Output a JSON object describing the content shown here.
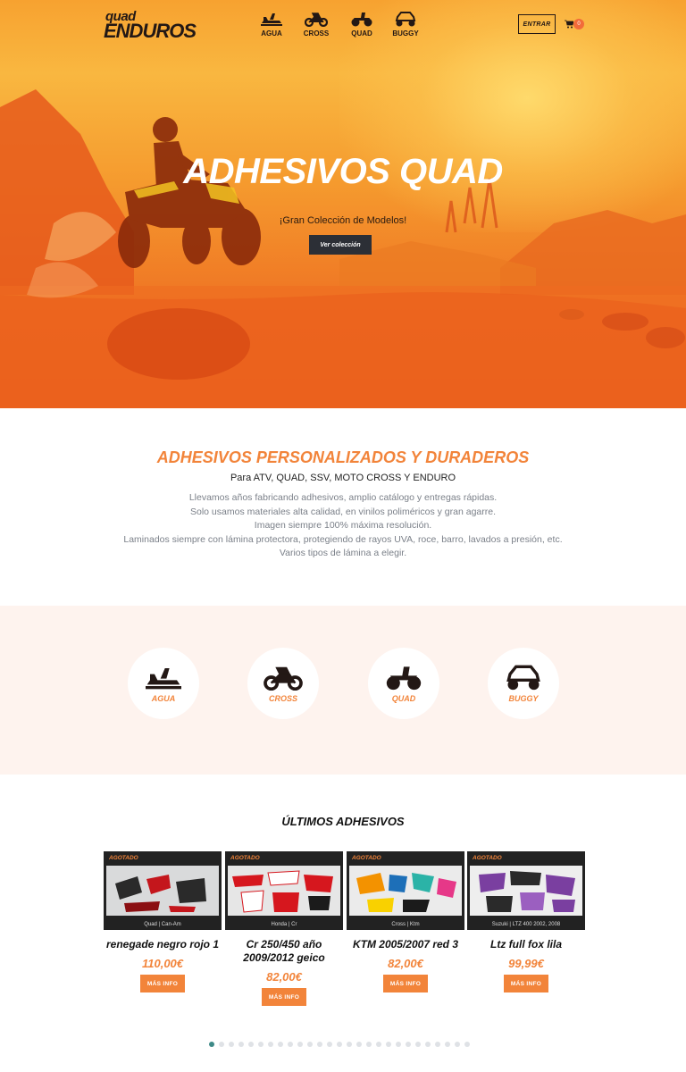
{
  "brand": {
    "logo_top": "quad",
    "logo_bottom": "ENDUROS"
  },
  "nav": [
    {
      "label": "AGUA",
      "icon": "jetski-icon"
    },
    {
      "label": "CROSS",
      "icon": "cross-bike-icon"
    },
    {
      "label": "QUAD",
      "icon": "quad-icon"
    },
    {
      "label": "BUGGY",
      "icon": "buggy-icon"
    }
  ],
  "header": {
    "login_label": "ENTRAR",
    "cart_count": "0"
  },
  "hero": {
    "title": "ADHESIVOS QUAD",
    "subtitle": "¡Gran Colección de Modelos!",
    "button_label": "Ver colección"
  },
  "intro": {
    "heading": "ADHESIVOS PERSONALIZADOS Y DURADEROS",
    "subheading": "Para ATV, QUAD, SSV, MOTO CROSS Y ENDURO",
    "lines": [
      "Llevamos años fabricando adhesivos, amplio catálogo y entregas rápidas.",
      "Solo usamos materiales alta calidad, en vinilos poliméricos y gran agarre.",
      "Imagen siempre 100% máxima resolución.",
      "Laminados siempre con lámina protectora, protegiendo de rayos UVA, roce, barro, lavados a presión, etc.",
      "Varios tipos de lámina a elegir."
    ]
  },
  "categories": [
    {
      "label": "AGUA"
    },
    {
      "label": "CROSS"
    },
    {
      "label": "QUAD"
    },
    {
      "label": "BUGGY"
    }
  ],
  "latest": {
    "title": "ÚLTIMOS ADHESIVOS",
    "products": [
      {
        "badge": "AGOTADO",
        "brand_line": "Quad  |  Can-Am",
        "name": "renegade negro rojo 1",
        "price": "110,00€",
        "button": "MÁS INFO"
      },
      {
        "badge": "AGOTADO",
        "brand_line": "Honda  |  Cr",
        "name": "Cr 250/450 año 2009/2012 geico",
        "price": "82,00€",
        "button": "MÁS INFO"
      },
      {
        "badge": "AGOTADO",
        "brand_line": "Cross  |  Ktm",
        "name": "KTM 2005/2007 red 3",
        "price": "82,00€",
        "button": "MÁS INFO"
      },
      {
        "badge": "AGOTADO",
        "brand_line": "Suzuki  |  LTZ 400 2002, 2008",
        "name": "Ltz full fox lila",
        "price": "99,99€",
        "button": "MÁS INFO"
      }
    ]
  },
  "carousel": {
    "page_count": 27,
    "active_page": 1
  },
  "colors": {
    "accent": "#f2843a",
    "dark": "#231815",
    "pale_band": "#fef3ee"
  }
}
